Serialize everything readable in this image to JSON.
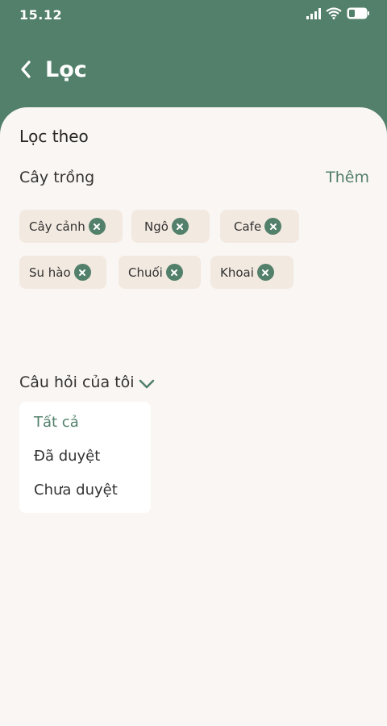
{
  "status": {
    "time": "15.12",
    "icons": [
      "signal-icon",
      "wifi-icon",
      "battery-icon"
    ]
  },
  "header": {
    "title": "Lọc",
    "back_icon": "chevron-left-icon"
  },
  "filter": {
    "heading": "Lọc theo",
    "crops": {
      "label": "Cây trồng",
      "add_label": "Thêm",
      "chips": [
        {
          "label": "Cây cảnh"
        },
        {
          "label": "Ngô"
        },
        {
          "label": "Cafe"
        },
        {
          "label": "Su hào"
        },
        {
          "label": "Chuối"
        },
        {
          "label": "Khoai"
        }
      ]
    },
    "questions": {
      "label": "Câu hỏi của tôi",
      "options": [
        {
          "label": "Tất cả",
          "selected": true
        },
        {
          "label": "Đã duyệt",
          "selected": false
        },
        {
          "label": "Chưa duyệt",
          "selected": false
        }
      ]
    }
  },
  "colors": {
    "primary": "#52806a",
    "background": "#faf6f3",
    "chip": "#f2e9e0"
  }
}
